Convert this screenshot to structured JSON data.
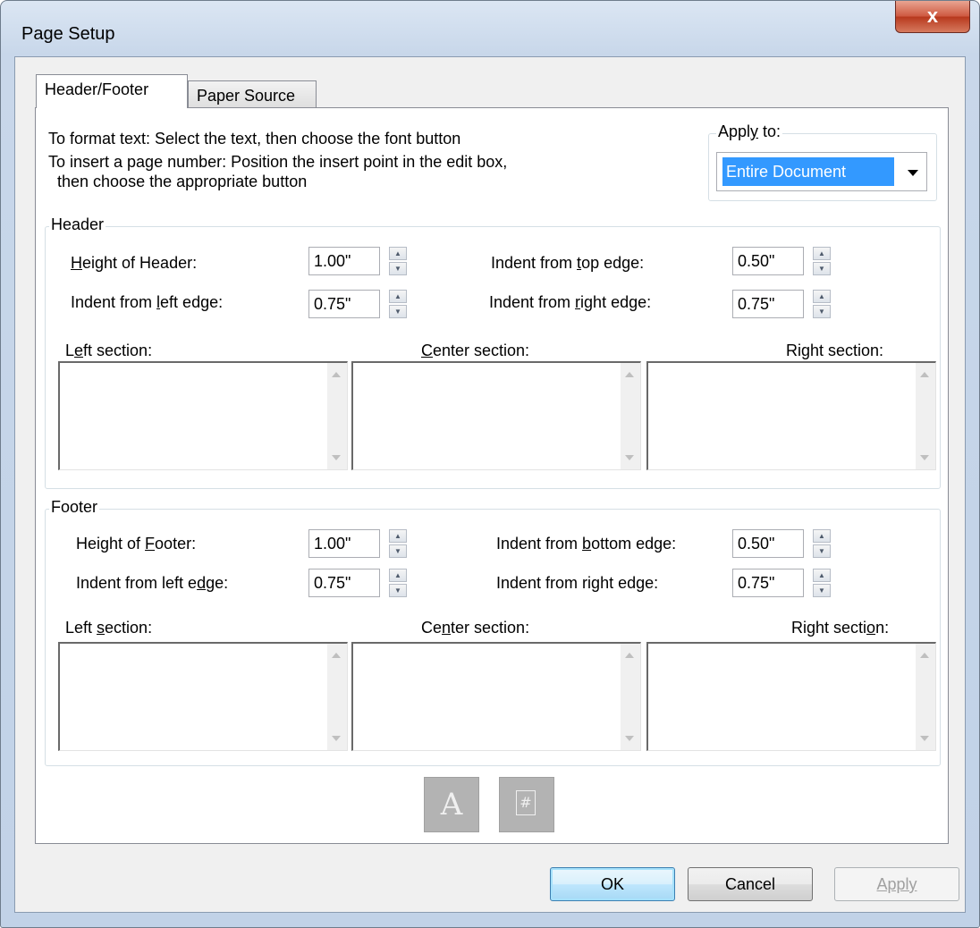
{
  "window": {
    "title": "Page Setup",
    "close_glyph": "x"
  },
  "tabs": [
    {
      "label": "Header/Footer"
    },
    {
      "label": "Paper Source"
    }
  ],
  "instructions": {
    "line1": "To format text: Select the text, then choose the font button",
    "line2": "To insert a page number: Position the insert point in the edit box,",
    "line3": "then choose the appropriate button"
  },
  "apply_to": {
    "label": "Apply to:",
    "value": "Entire Document"
  },
  "header": {
    "group_label": "Header",
    "height_label": "Height of Header:",
    "height_value": "1.00\"",
    "top_label": "Indent from top edge:",
    "top_value": "0.50\"",
    "left_label": "Indent from left edge:",
    "left_value": "0.75\"",
    "right_label": "Indent from right edge:",
    "right_value": "0.75\"",
    "left_section": "Left section:",
    "center_section": "Center section:",
    "right_section": "Right section:",
    "left_text": "",
    "center_text": "",
    "right_text": ""
  },
  "footer": {
    "group_label": "Footer",
    "height_label": "Height of Footer:",
    "height_value": "1.00\"",
    "bottom_label": "Indent from bottom edge:",
    "bottom_value": "0.50\"",
    "left_label": "Indent from left edge:",
    "left_value": "0.75\"",
    "right_label": "Indent from right edge:",
    "right_value": "0.75\"",
    "left_section": "Left section:",
    "center_section": "Center section:",
    "right_section": "Right section:",
    "left_text": "",
    "center_text": "",
    "right_text": ""
  },
  "tool_buttons": {
    "font_glyph": "A",
    "page_number_glyph": "#"
  },
  "buttons": {
    "ok": "OK",
    "cancel": "Cancel",
    "apply": "Apply"
  }
}
